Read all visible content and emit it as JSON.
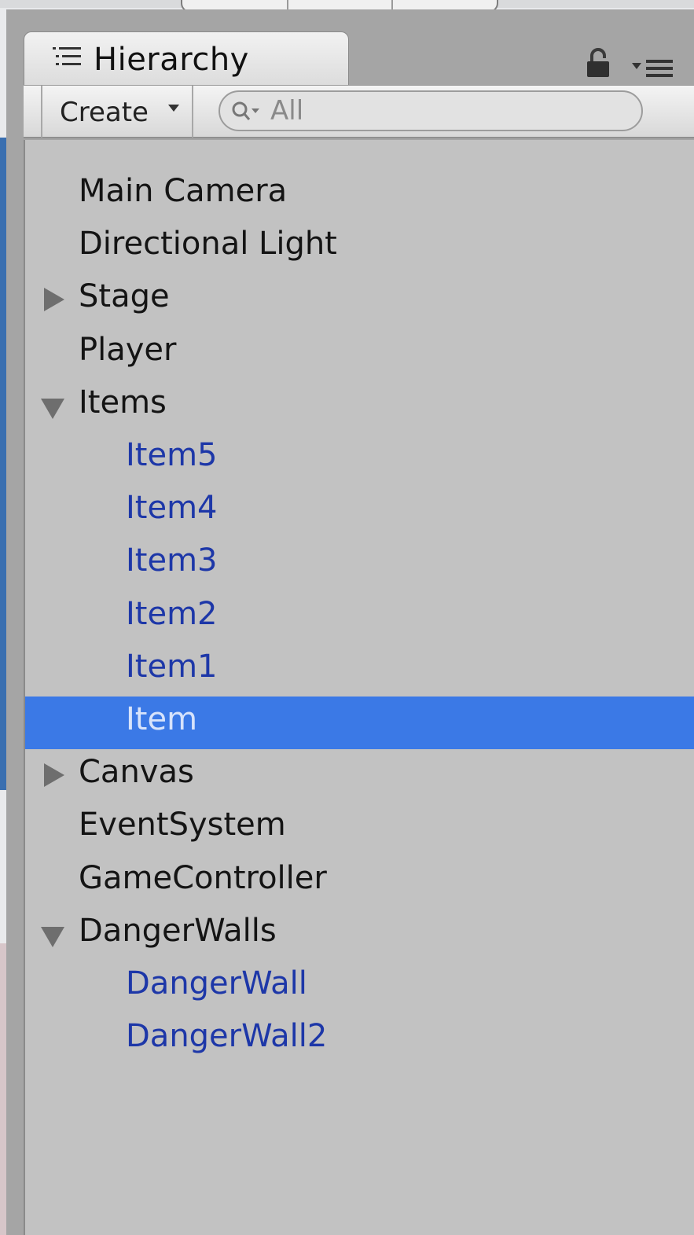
{
  "window": {
    "tab_title": "Hierarchy"
  },
  "toolbar": {
    "create_label": "Create",
    "search_placeholder": "All"
  },
  "hierarchy": {
    "items": [
      {
        "label": "Main Camera",
        "depth": 0,
        "foldout": "none",
        "prefab": false,
        "selected": false
      },
      {
        "label": "Directional Light",
        "depth": 0,
        "foldout": "none",
        "prefab": false,
        "selected": false
      },
      {
        "label": "Stage",
        "depth": 0,
        "foldout": "collapsed",
        "prefab": false,
        "selected": false
      },
      {
        "label": "Player",
        "depth": 0,
        "foldout": "none",
        "prefab": false,
        "selected": false
      },
      {
        "label": "Items",
        "depth": 0,
        "foldout": "expanded",
        "prefab": false,
        "selected": false
      },
      {
        "label": "Item5",
        "depth": 1,
        "foldout": "none",
        "prefab": true,
        "selected": false
      },
      {
        "label": "Item4",
        "depth": 1,
        "foldout": "none",
        "prefab": true,
        "selected": false
      },
      {
        "label": "Item3",
        "depth": 1,
        "foldout": "none",
        "prefab": true,
        "selected": false
      },
      {
        "label": "Item2",
        "depth": 1,
        "foldout": "none",
        "prefab": true,
        "selected": false
      },
      {
        "label": "Item1",
        "depth": 1,
        "foldout": "none",
        "prefab": true,
        "selected": false
      },
      {
        "label": "Item",
        "depth": 1,
        "foldout": "none",
        "prefab": true,
        "selected": true
      },
      {
        "label": "Canvas",
        "depth": 0,
        "foldout": "collapsed",
        "prefab": false,
        "selected": false
      },
      {
        "label": "EventSystem",
        "depth": 0,
        "foldout": "none",
        "prefab": false,
        "selected": false
      },
      {
        "label": "GameController",
        "depth": 0,
        "foldout": "none",
        "prefab": false,
        "selected": false
      },
      {
        "label": "DangerWalls",
        "depth": 0,
        "foldout": "expanded",
        "prefab": false,
        "selected": false
      },
      {
        "label": "DangerWall",
        "depth": 1,
        "foldout": "none",
        "prefab": true,
        "selected": false
      },
      {
        "label": "DangerWall2",
        "depth": 1,
        "foldout": "none",
        "prefab": true,
        "selected": false
      }
    ]
  },
  "colors": {
    "selection": "#3b79e6",
    "prefab_text": "#1d37a8",
    "list_background": "#c2c2c2"
  },
  "icons": {
    "tab": "list-icon",
    "lock": "lock-icon",
    "menu": "menu-icon",
    "search": "search-icon"
  }
}
